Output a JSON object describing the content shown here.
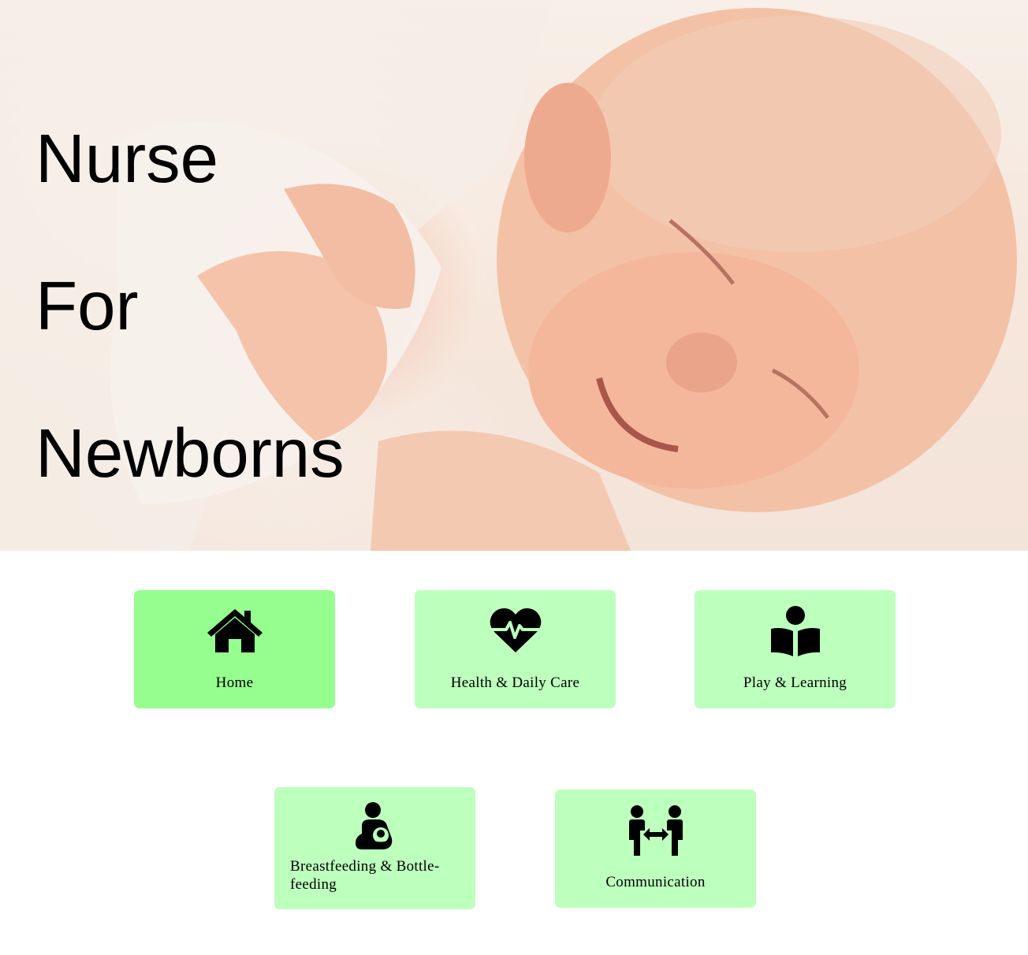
{
  "hero": {
    "title_lines": [
      "Nurse",
      "For",
      "Newborns"
    ]
  },
  "nav": {
    "items": [
      {
        "label": "Home",
        "icon": "home-icon",
        "active": true
      },
      {
        "label": "Health & Daily Care",
        "icon": "heart-pulse-icon",
        "active": false
      },
      {
        "label": "Play & Learning",
        "icon": "book-reader-icon",
        "active": false
      },
      {
        "label": "Breastfeeding & Bottle-feeding",
        "icon": "breastfeeding-icon",
        "active": false
      },
      {
        "label": "Communication",
        "icon": "people-arrows-icon",
        "active": false
      }
    ]
  },
  "colors": {
    "card_background": "#bdffbd",
    "card_active": "#95fe8f",
    "text": "#000000"
  }
}
